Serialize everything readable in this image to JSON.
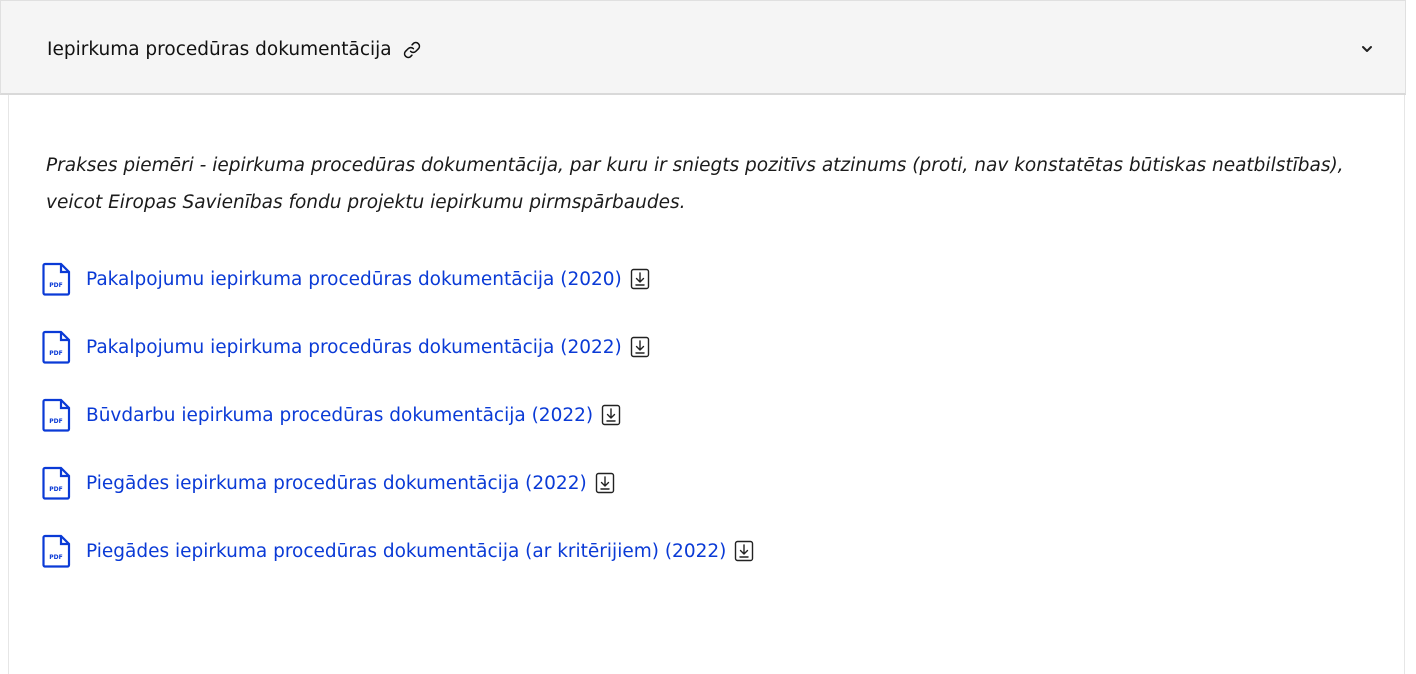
{
  "accordion": {
    "title": "Iepirkuma procedūras dokumentācija",
    "link_icon": "link-icon",
    "toggle_icon": "chevron-down-icon",
    "intro": "Prakses piemēri - iepirkuma procedūras dokumentācija, par kuru ir sniegts pozitīvs atzinums (proti, nav konstatētas būtiskas neatbilstības), veicot Eiropas Savienības fondu projektu iepirkumu pirmspārbaudes.",
    "documents": [
      {
        "label": "Pakalpojumu iepirkuma procedūras dokumentācija (2020)",
        "file_icon": "pdf-file-icon",
        "action_icon": "download-icon"
      },
      {
        "label": "Pakalpojumu iepirkuma procedūras dokumentācija (2022)",
        "file_icon": "pdf-file-icon",
        "action_icon": "download-icon"
      },
      {
        "label": "Būvdarbu iepirkuma procedūras dokumentācija (2022)",
        "file_icon": "pdf-file-icon",
        "action_icon": "download-icon"
      },
      {
        "label": "Piegādes iepirkuma procedūras dokumentācija (2022)",
        "file_icon": "pdf-file-icon",
        "action_icon": "download-icon"
      },
      {
        "label": "Piegādes iepirkuma procedūras dokumentācija (ar kritērijiem) (2022)",
        "file_icon": "pdf-file-icon",
        "action_icon": "download-icon"
      }
    ],
    "pdf_badge_text": "PDF"
  },
  "colors": {
    "link": "#0a3ad6",
    "header_bg": "#f5f5f5",
    "text": "#1b1b1b"
  }
}
